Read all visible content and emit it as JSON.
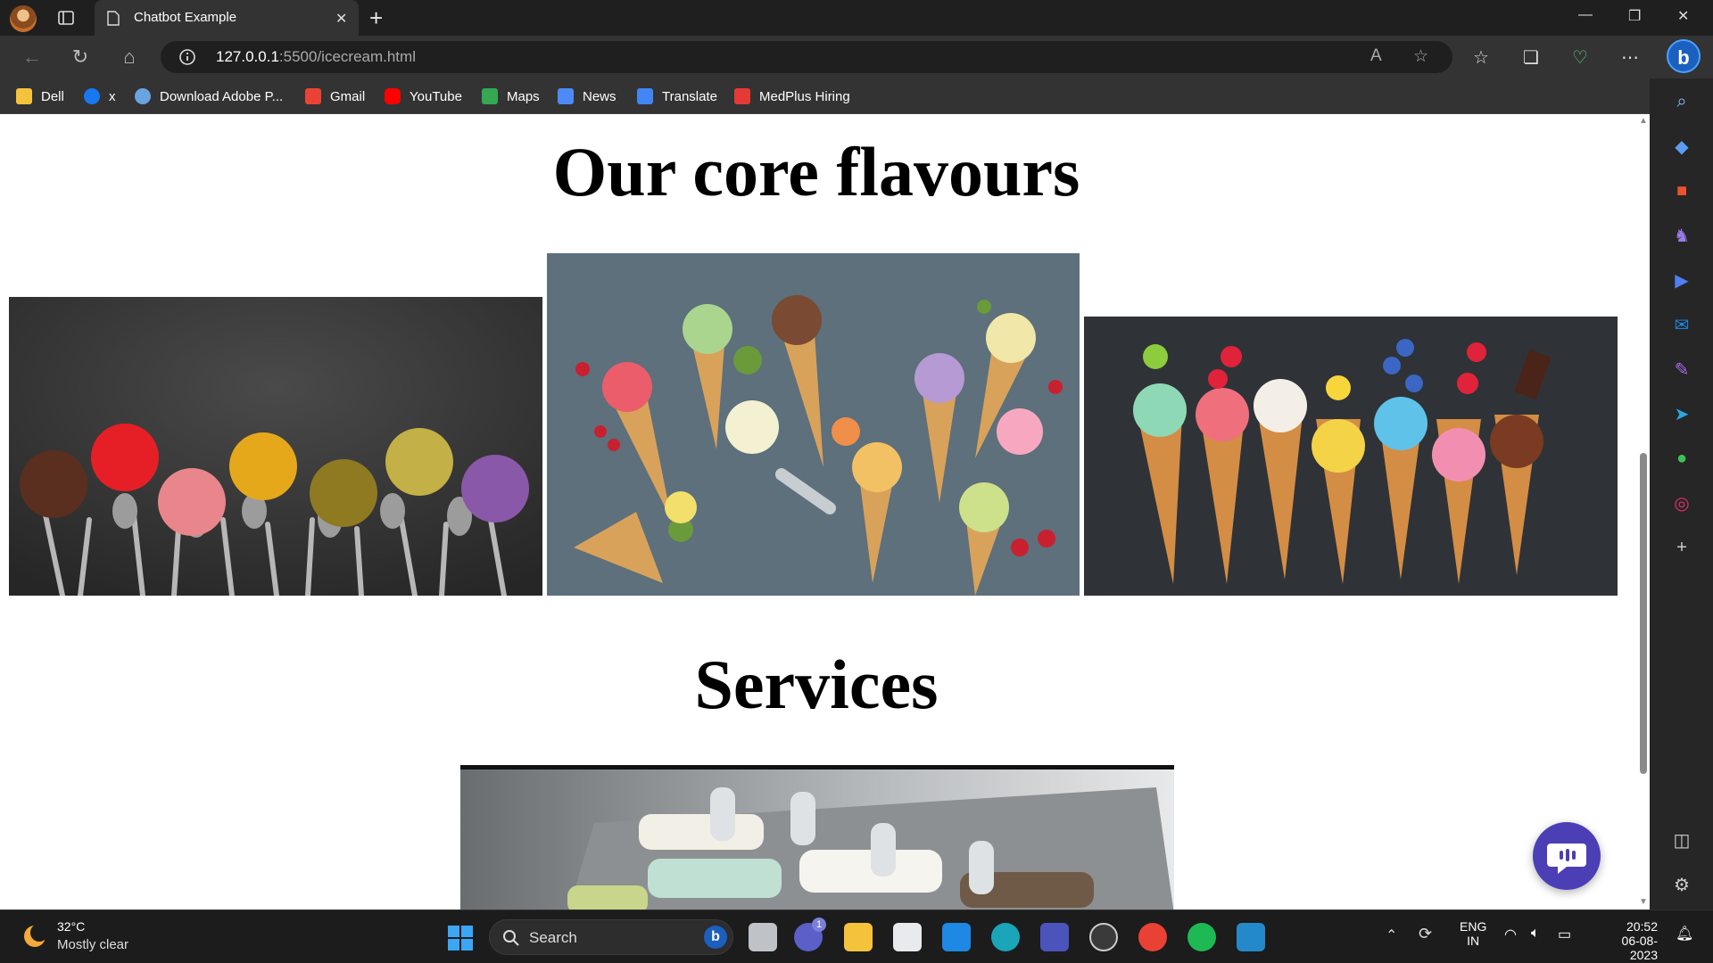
{
  "browser": {
    "tab_title": "Chatbot Example",
    "url_host": "127.0.0.1",
    "url_path": ":5500/icecream.html"
  },
  "bookmarks": [
    {
      "label": "Dell",
      "icon": "folder-icon",
      "color": "#f5c33b"
    },
    {
      "label": "x",
      "icon": "facebook-icon",
      "color": "#1877f2"
    },
    {
      "label": "Download Adobe P...",
      "icon": "adobe-globe-icon",
      "color": "#6aa4e0"
    },
    {
      "label": "Gmail",
      "icon": "gmail-icon",
      "color": "#ea4335"
    },
    {
      "label": "YouTube",
      "icon": "youtube-icon",
      "color": "#ff0000"
    },
    {
      "label": "Maps",
      "icon": "maps-icon",
      "color": "#34a853"
    },
    {
      "label": "News",
      "icon": "news-icon",
      "color": "#4c8bf5"
    },
    {
      "label": "Translate",
      "icon": "translate-icon",
      "color": "#4285f4"
    },
    {
      "label": "MedPlus Hiring",
      "icon": "medplus-icon",
      "color": "#e53935"
    }
  ],
  "page": {
    "heading_flavours": "Our core flavours",
    "heading_services": "Services"
  },
  "taskbar": {
    "weather_temp": "32°C",
    "weather_desc": "Mostly clear",
    "search_label": "Search",
    "lang_line1": "ENG",
    "lang_line2": "IN",
    "time": "20:52",
    "date": "06-08-2023",
    "teams_badge": "1"
  },
  "colors": {
    "chrome_dark": "#1f1f1f",
    "toolbar": "#333333",
    "chat_fab": "#4c3fb5",
    "accent": "#3aa6f5"
  }
}
